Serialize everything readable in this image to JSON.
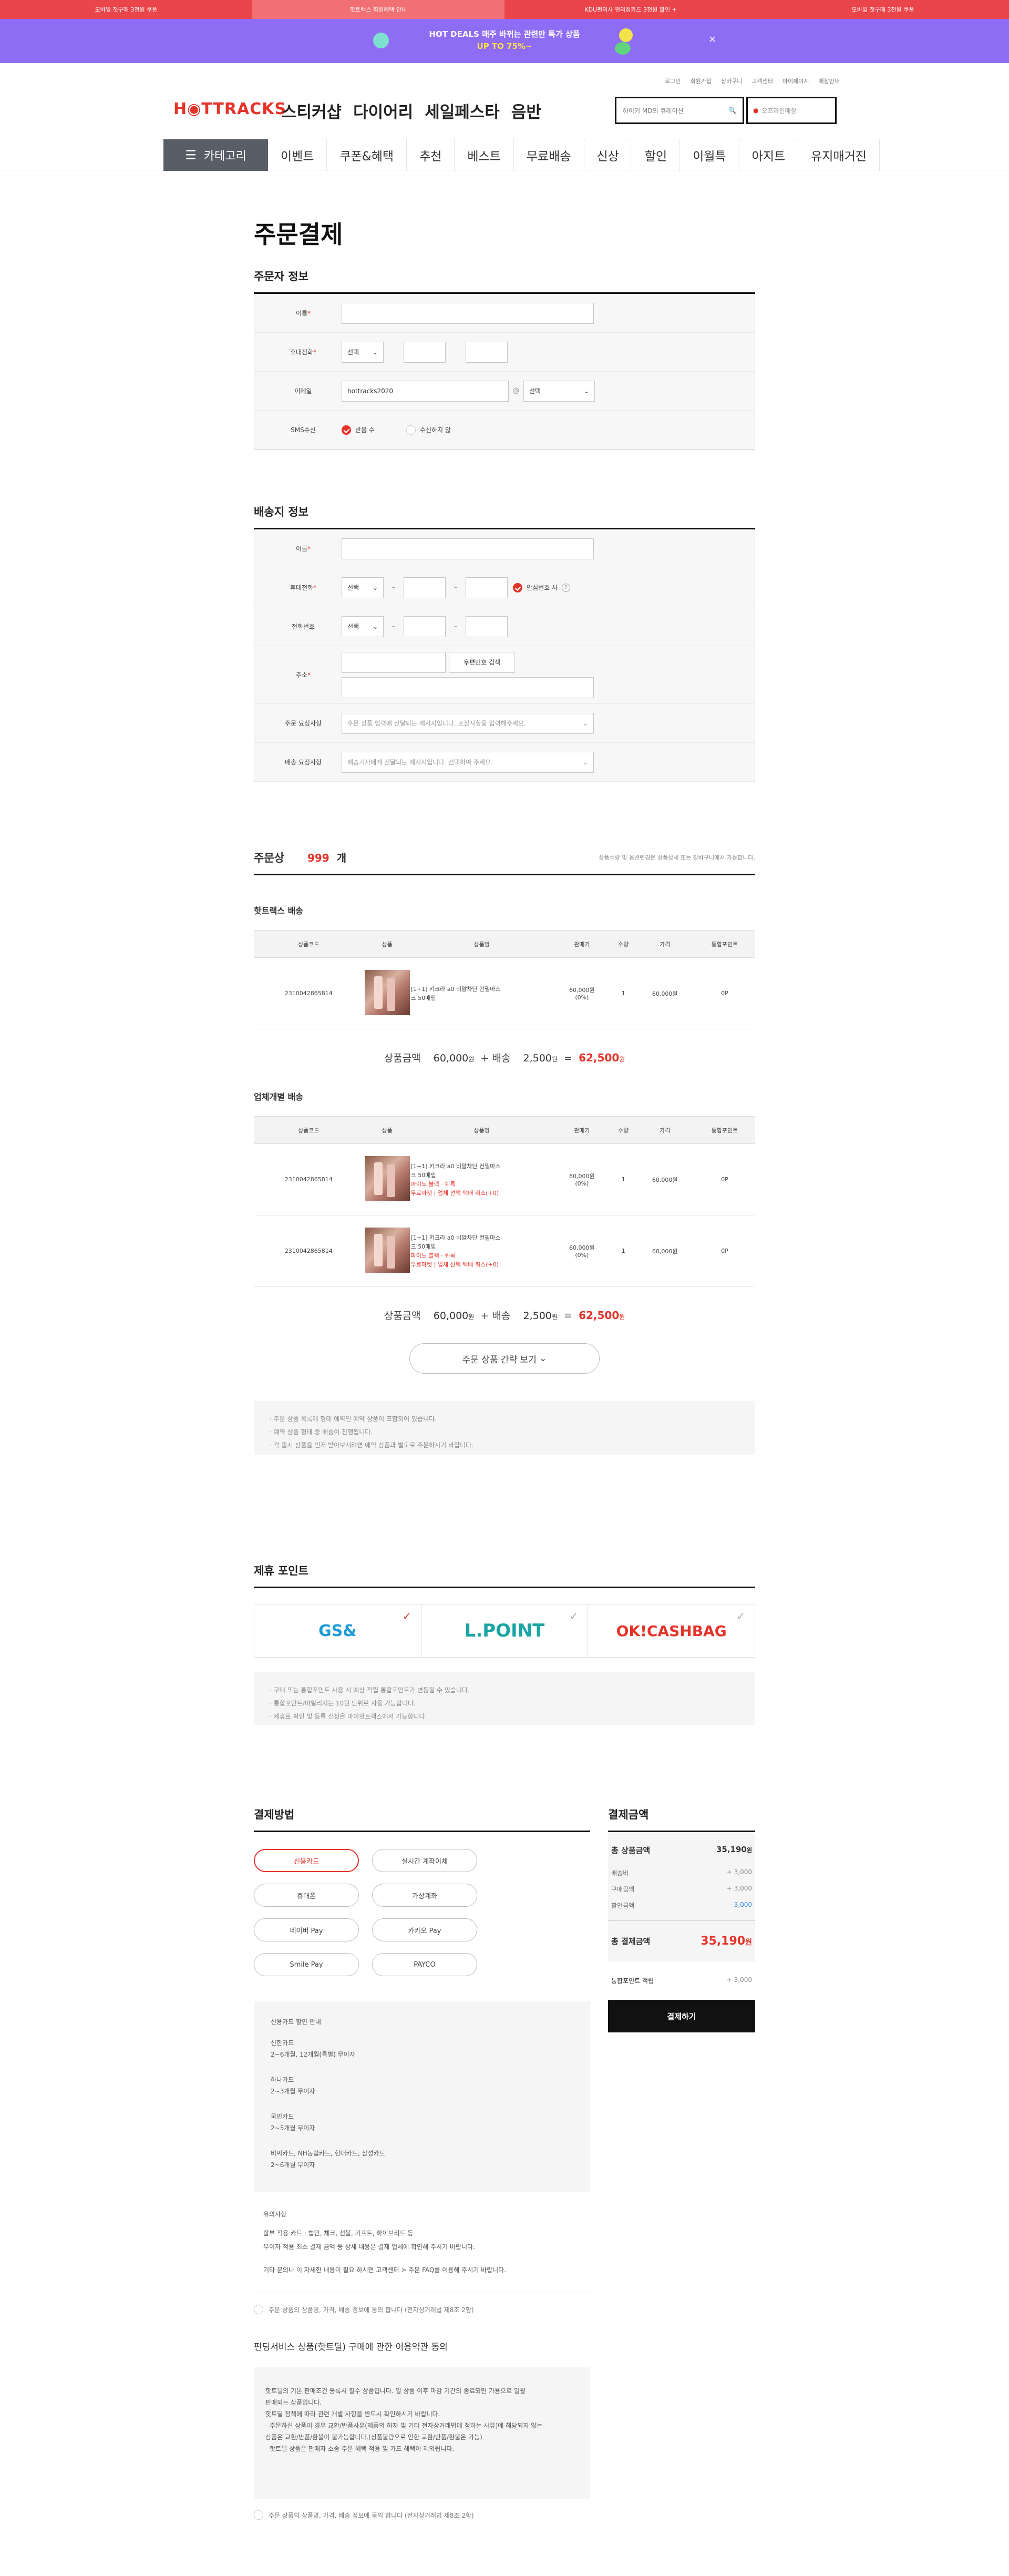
{
  "topbar": [
    "모바일 첫구매 3천원 쿠폰",
    "핫트랙스 회원혜택 안내",
    "KDU편의사 편의점카드 3천원 할인 +",
    "모바일 첫구매 3천원 쿠폰"
  ],
  "deal": {
    "title": "HOT DEALS 매주 바뀌는 관련만 특가 상품",
    "subtitle": "UP TO 75%~",
    "close": "×"
  },
  "utils": [
    "로그인",
    "회원가입",
    "장바구니",
    "고객센터",
    "마이페이지",
    "매장안내"
  ],
  "logo": "H◉TTRACKS",
  "header_cats": [
    "스티커샵",
    "다이어리",
    "세일페스타",
    "음반"
  ],
  "search": {
    "placeholder": "하이키 MD의 큐레이션",
    "icon": "🔍",
    "store_placeholder": "오프라인매장"
  },
  "nav": {
    "category": "카테고리",
    "items": [
      "이벤트",
      "쿠폰&혜택",
      "추천",
      "베스트",
      "무료배송",
      "신상",
      "할인",
      "이월특",
      "아지트",
      "유지매거진"
    ]
  },
  "page_title": "주문결제",
  "orderer": {
    "title": "주문자 정보",
    "name_label": "이름",
    "phone_label": "휴대전화",
    "email_label": "이메일",
    "sms_label": "SMS수신",
    "select": "선택",
    "email_value": "hottracks2020",
    "at": "@",
    "sms_yes": "받음 수",
    "sms_no": "수신하지 않"
  },
  "shipping": {
    "title": "배송지 정보",
    "name_label": "이름",
    "phone_label": "휴대전화",
    "tel_label": "전화번호",
    "addr_label": "주소",
    "zip_btn": "우편번호 검색",
    "req_label": "주문 요청사항",
    "req_placeholder": "주문 상품 입력에 전달되는 메시지입니다. 포장사항을 입력해주세요.",
    "del_label": "배송 요청사항",
    "del_placeholder": "배송기사에게 전달되는 메시지입니다. 선택하여 주세요.",
    "safe": "안심번호 사"
  },
  "products": {
    "title": "주문상",
    "count": "999",
    "unit": "개",
    "note": "상품수량 및 옵션변경은 상품상세 또는 장바구니에서 가능합니다.",
    "group1": "핫트랙스 배송",
    "group2": "업체개별 배송",
    "headers": [
      "상품코드",
      "상품",
      "상품명",
      "판매가",
      "수량",
      "가격",
      "통합포인트"
    ],
    "rows1": [
      {
        "code": "2310042865814",
        "name": "[1+1] 키크라 a0 비말차단 컨필마스크 50매입",
        "price": "60,000원",
        "rate": "(0%)",
        "qty": "1",
        "total": "60,000원",
        "point": "0P",
        "opt": "",
        "opt2": ""
      }
    ],
    "rows2": [
      {
        "code": "2310042865814",
        "name": "[1+1] 키크라 a0 비말차단 컨필마스크 50매입",
        "price": "60,000원",
        "rate": "(0%)",
        "qty": "1",
        "total": "60,000원",
        "point": "0P",
        "opt": "파이노 블랙 · 쉬록",
        "opt2": "무료마켓 | 업체 선택 택배 취소(+0)"
      },
      {
        "code": "2310042865814",
        "name": "[1+1] 키크라 a0 비말차단 컨필마스크 50매입",
        "price": "60,000원",
        "rate": "(0%)",
        "qty": "1",
        "total": "60,000원",
        "point": "0P",
        "opt": "파이노 블랙 · 쉬록",
        "opt2": "무료마켓 | 업체 선택 택배 취소(+0)"
      }
    ],
    "sum": {
      "label": "상품금액",
      "amount": "60,000",
      "won": "원",
      "plus": "+ 배송",
      "ship": "2,500",
      "eq": "=",
      "total": "62,500"
    },
    "more": "주문 상품 간략 보기",
    "notes": [
      "· 주문 상품 목록에 형태 예약인 예약 상품이 포함되어 있습니다.",
      "· 예약 상품 형태 중 배송이 진행됩니다.",
      "· 각 출시 상품을 먼저 받아보시려면 예약 상품과 별도로 주문하시기 바랍니다."
    ]
  },
  "partner": {
    "title": "제휴 포인트",
    "items": [
      "GS&",
      "L.POINT",
      "OK!CASHBAG"
    ],
    "notes": [
      "· 구매 또는 통합포인트 사용 시 예상 적립 통합포인트가 변동될 수 있습니다.",
      "· 통합포인트/마일리지는 10원 단위로 사용 가능합니다.",
      "· 제휴로 확인 및 등록 신청은 마이핫트랙스에서 가능합니다."
    ]
  },
  "payment": {
    "title": "결제방법",
    "methods": [
      "신용카드",
      "실시간 계좌이체",
      "휴대폰",
      "가상계좌",
      "네이버 Pay",
      "카카오 Pay",
      "Smile Pay",
      "PAYCO"
    ],
    "card_title": "신용카드 할인 안내",
    "cards": [
      [
        "신한카드",
        "2~6개월, 12개월(특별) 무이자"
      ],
      [
        "하나카드",
        "2~3개월 무이자"
      ],
      [
        "국민카드",
        "2~5개월 무이자"
      ],
      [
        "비씨카드, NH농협카드, 현대카드, 삼성카드",
        "2~6개월 무이자"
      ]
    ],
    "caution_title": "유의사항",
    "caution": [
      "할부 적용 카드 : 법인, 체크, 선불, 기프트, 하이브리드 등",
      "무이자 적용 최소 결제 금액 등 상세 내용은 결제 업체에 확인해 주시기 바랍니다.",
      "기타 문의나 이 자세한 내용이 필요 하시면 고객센터 > 주문 FAQ를 이용해 주시기 바랍니다."
    ],
    "agree1": "주문 상품의 상품명, 가격, 배송 정보에 동의 합니다 (전자상거래법 제8조 2항)",
    "terms_title": "펀딩서비스 상품(핫트딜) 구매에 관한 이용약관 동의",
    "terms": [
      "핫트딜의 기본 판매조건 등록시 필수 상품입니다. 일 상품 이후 마감 기간의 종료되면 가용으로 일괄",
      "판매되는 상품입니다.",
      "핫트딜 정책에 따라 관련 개별 사항을 반드시 확인하시기 바랍니다.",
      "- 주문하신 상품이 경우 교환/반품사유(제품의 하자 및 기타 전자상거래법에 정하는 사유)에 해당되지 않는",
      "상품은 교환/반품/환불이 불가능합니다.(상품불량으로 인한 교환/반품/환불은 가능)",
      "- 핫트딜 상품은 판매자 소송 주문 혜택 적용 및 카드 혜택이 제외됩니다."
    ],
    "agree2": "주문 상품의 상품명, 가격, 배송 정보에 동의 합니다 (전자상거래법 제8조 2항)"
  },
  "summary": {
    "title": "결제금액",
    "total_label": "총 상품금액",
    "total": "35,190",
    "won": "원",
    "lines": [
      [
        "배송비",
        "+ 3,000"
      ],
      [
        "구매금액",
        "+ 3,000"
      ],
      [
        "할인금액",
        "- 3,000"
      ]
    ],
    "pay_label": "총 결제금액",
    "pay": "35,190",
    "pay_won": "원",
    "point_label": "통합포인트 적립",
    "point": "+ 3,000",
    "button": "결제하기"
  }
}
